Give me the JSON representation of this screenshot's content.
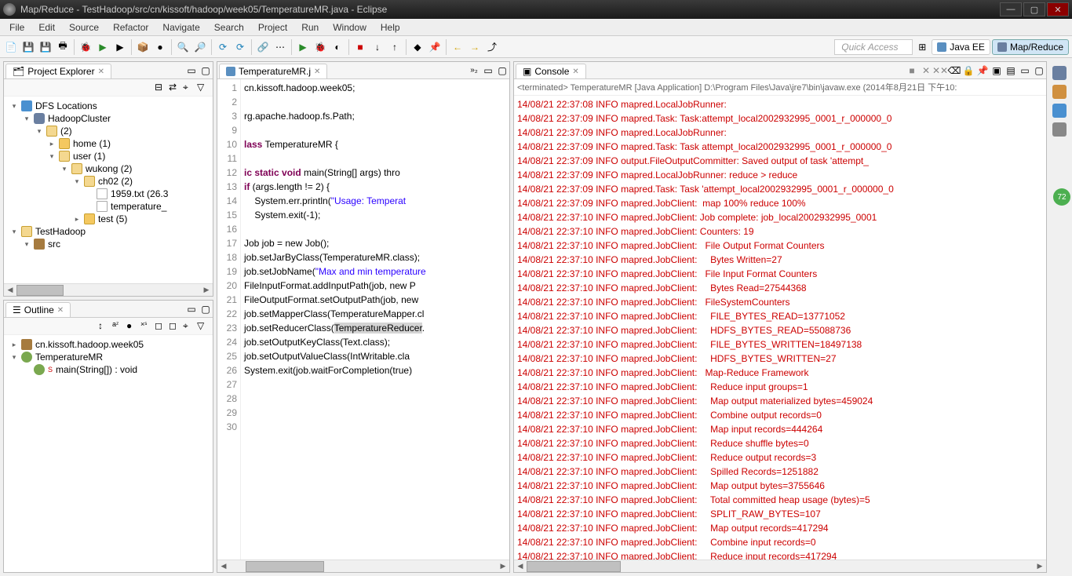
{
  "window": {
    "title": "Map/Reduce - TestHadoop/src/cn/kissoft/hadoop/week05/TemperatureMR.java - Eclipse"
  },
  "menu": [
    "File",
    "Edit",
    "Source",
    "Refactor",
    "Navigate",
    "Search",
    "Project",
    "Run",
    "Window",
    "Help"
  ],
  "quick_access": "Quick Access",
  "perspectives": [
    {
      "label": "Java EE",
      "active": false
    },
    {
      "label": "Map/Reduce",
      "active": true
    }
  ],
  "project_explorer": {
    "title": "Project Explorer",
    "nodes": [
      {
        "indent": 0,
        "twi": "▾",
        "icon": "dfs",
        "label": "DFS Locations"
      },
      {
        "indent": 1,
        "twi": "▾",
        "icon": "elephant",
        "label": "HadoopCluster"
      },
      {
        "indent": 2,
        "twi": "▾",
        "icon": "folder-open",
        "label": "(2)"
      },
      {
        "indent": 3,
        "twi": "▸",
        "icon": "folder",
        "label": "home (1)"
      },
      {
        "indent": 3,
        "twi": "▾",
        "icon": "folder-open",
        "label": "user (1)"
      },
      {
        "indent": 4,
        "twi": "▾",
        "icon": "folder-open",
        "label": "wukong (2)"
      },
      {
        "indent": 5,
        "twi": "▾",
        "icon": "folder-open",
        "label": "ch02 (2)"
      },
      {
        "indent": 6,
        "twi": "",
        "icon": "file",
        "label": "1959.txt (26.3"
      },
      {
        "indent": 6,
        "twi": "",
        "icon": "file",
        "label": "temperature_"
      },
      {
        "indent": 5,
        "twi": "▸",
        "icon": "folder",
        "label": "test (5)"
      },
      {
        "indent": 0,
        "twi": "▾",
        "icon": "folder-open",
        "label": "TestHadoop"
      },
      {
        "indent": 1,
        "twi": "▾",
        "icon": "pkg",
        "label": "src"
      }
    ]
  },
  "outline": {
    "title": "Outline",
    "nodes": [
      {
        "indent": 0,
        "twi": "▸",
        "icon": "pkg",
        "label": "cn.kissoft.hadoop.week05"
      },
      {
        "indent": 0,
        "twi": "▾",
        "icon": "class",
        "label": "TemperatureMR"
      },
      {
        "indent": 1,
        "twi": "",
        "icon": "method",
        "label": "main(String[]) : void",
        "sup": "S"
      }
    ]
  },
  "editor": {
    "tab": "TemperatureMR.j",
    "lines": [
      {
        "n": 1,
        "raw": "cn.kissoft.hadoop.week05;"
      },
      {
        "n": 2,
        "raw": ""
      },
      {
        "n": 3,
        "raw": "rg.apache.hadoop.fs.Path;"
      },
      {
        "n": 9,
        "raw": ""
      },
      {
        "n": 10,
        "kw": "lass",
        "rest": " TemperatureMR {"
      },
      {
        "n": 11,
        "raw": ""
      },
      {
        "n": 12,
        "kw": "ic static void",
        "rest": " main(String[] args) thro"
      },
      {
        "n": 13,
        "kw": "if",
        "rest": " (args.length != 2) {"
      },
      {
        "n": 14,
        "pre": "    System.err.println(",
        "str": "\"Usage: Temperat"
      },
      {
        "n": 15,
        "raw": "    System.exit(-1);"
      },
      {
        "n": 16,
        "raw": ""
      },
      {
        "n": 17,
        "raw": "Job job = new Job();"
      },
      {
        "n": 18,
        "raw": "job.setJarByClass(TemperatureMR.class);"
      },
      {
        "n": 19,
        "pre": "job.setJobName(",
        "str": "\"Max and min temperature"
      },
      {
        "n": 20,
        "raw": "FileInputFormat.addInputPath(job, new P"
      },
      {
        "n": 21,
        "raw": "FileOutputFormat.setOutputPath(job, new"
      },
      {
        "n": 22,
        "raw": "job.setMapperClass(TemperatureMapper.cl"
      },
      {
        "n": 23,
        "pre": "job.setReducerClass(",
        "hl": "TemperatureReducer",
        "post": "."
      },
      {
        "n": 24,
        "raw": "job.setOutputKeyClass(Text.class);"
      },
      {
        "n": 25,
        "raw": "job.setOutputValueClass(IntWritable.cla"
      },
      {
        "n": 26,
        "raw": "System.exit(job.waitForCompletion(true)"
      },
      {
        "n": 27,
        "raw": ""
      },
      {
        "n": 28,
        "raw": ""
      },
      {
        "n": 29,
        "raw": ""
      },
      {
        "n": 30,
        "raw": ""
      }
    ]
  },
  "console": {
    "title": "Console",
    "head": "<terminated> TemperatureMR [Java Application] D:\\Program Files\\Java\\jre7\\bin\\javaw.exe (2014年8月21日 下午10:",
    "lines": [
      "14/08/21 22:37:08 INFO mapred.LocalJobRunner: ",
      "14/08/21 22:37:09 INFO mapred.Task: Task:attempt_local2002932995_0001_r_000000_0",
      "14/08/21 22:37:09 INFO mapred.LocalJobRunner: ",
      "14/08/21 22:37:09 INFO mapred.Task: Task attempt_local2002932995_0001_r_000000_0",
      "14/08/21 22:37:09 INFO output.FileOutputCommitter: Saved output of task 'attempt_",
      "14/08/21 22:37:09 INFO mapred.LocalJobRunner: reduce > reduce",
      "14/08/21 22:37:09 INFO mapred.Task: Task 'attempt_local2002932995_0001_r_000000_0",
      "14/08/21 22:37:09 INFO mapred.JobClient:  map 100% reduce 100%",
      "14/08/21 22:37:10 INFO mapred.JobClient: Job complete: job_local2002932995_0001",
      "14/08/21 22:37:10 INFO mapred.JobClient: Counters: 19",
      "14/08/21 22:37:10 INFO mapred.JobClient:   File Output Format Counters ",
      "14/08/21 22:37:10 INFO mapred.JobClient:     Bytes Written=27",
      "14/08/21 22:37:10 INFO mapred.JobClient:   File Input Format Counters ",
      "14/08/21 22:37:10 INFO mapred.JobClient:     Bytes Read=27544368",
      "14/08/21 22:37:10 INFO mapred.JobClient:   FileSystemCounters",
      "14/08/21 22:37:10 INFO mapred.JobClient:     FILE_BYTES_READ=13771052",
      "14/08/21 22:37:10 INFO mapred.JobClient:     HDFS_BYTES_READ=55088736",
      "14/08/21 22:37:10 INFO mapred.JobClient:     FILE_BYTES_WRITTEN=18497138",
      "14/08/21 22:37:10 INFO mapred.JobClient:     HDFS_BYTES_WRITTEN=27",
      "14/08/21 22:37:10 INFO mapred.JobClient:   Map-Reduce Framework",
      "14/08/21 22:37:10 INFO mapred.JobClient:     Reduce input groups=1",
      "14/08/21 22:37:10 INFO mapred.JobClient:     Map output materialized bytes=459024",
      "14/08/21 22:37:10 INFO mapred.JobClient:     Combine output records=0",
      "14/08/21 22:37:10 INFO mapred.JobClient:     Map input records=444264",
      "14/08/21 22:37:10 INFO mapred.JobClient:     Reduce shuffle bytes=0",
      "14/08/21 22:37:10 INFO mapred.JobClient:     Reduce output records=3",
      "14/08/21 22:37:10 INFO mapred.JobClient:     Spilled Records=1251882",
      "14/08/21 22:37:10 INFO mapred.JobClient:     Map output bytes=3755646",
      "14/08/21 22:37:10 INFO mapred.JobClient:     Total committed heap usage (bytes)=5",
      "14/08/21 22:37:10 INFO mapred.JobClient:     SPLIT_RAW_BYTES=107",
      "14/08/21 22:37:10 INFO mapred.JobClient:     Map output records=417294",
      "14/08/21 22:37:10 INFO mapred.JobClient:     Combine input records=0",
      "14/08/21 22:37:10 INFO mapred.JobClient:     Reduce input records=417294"
    ]
  },
  "badge": "72"
}
